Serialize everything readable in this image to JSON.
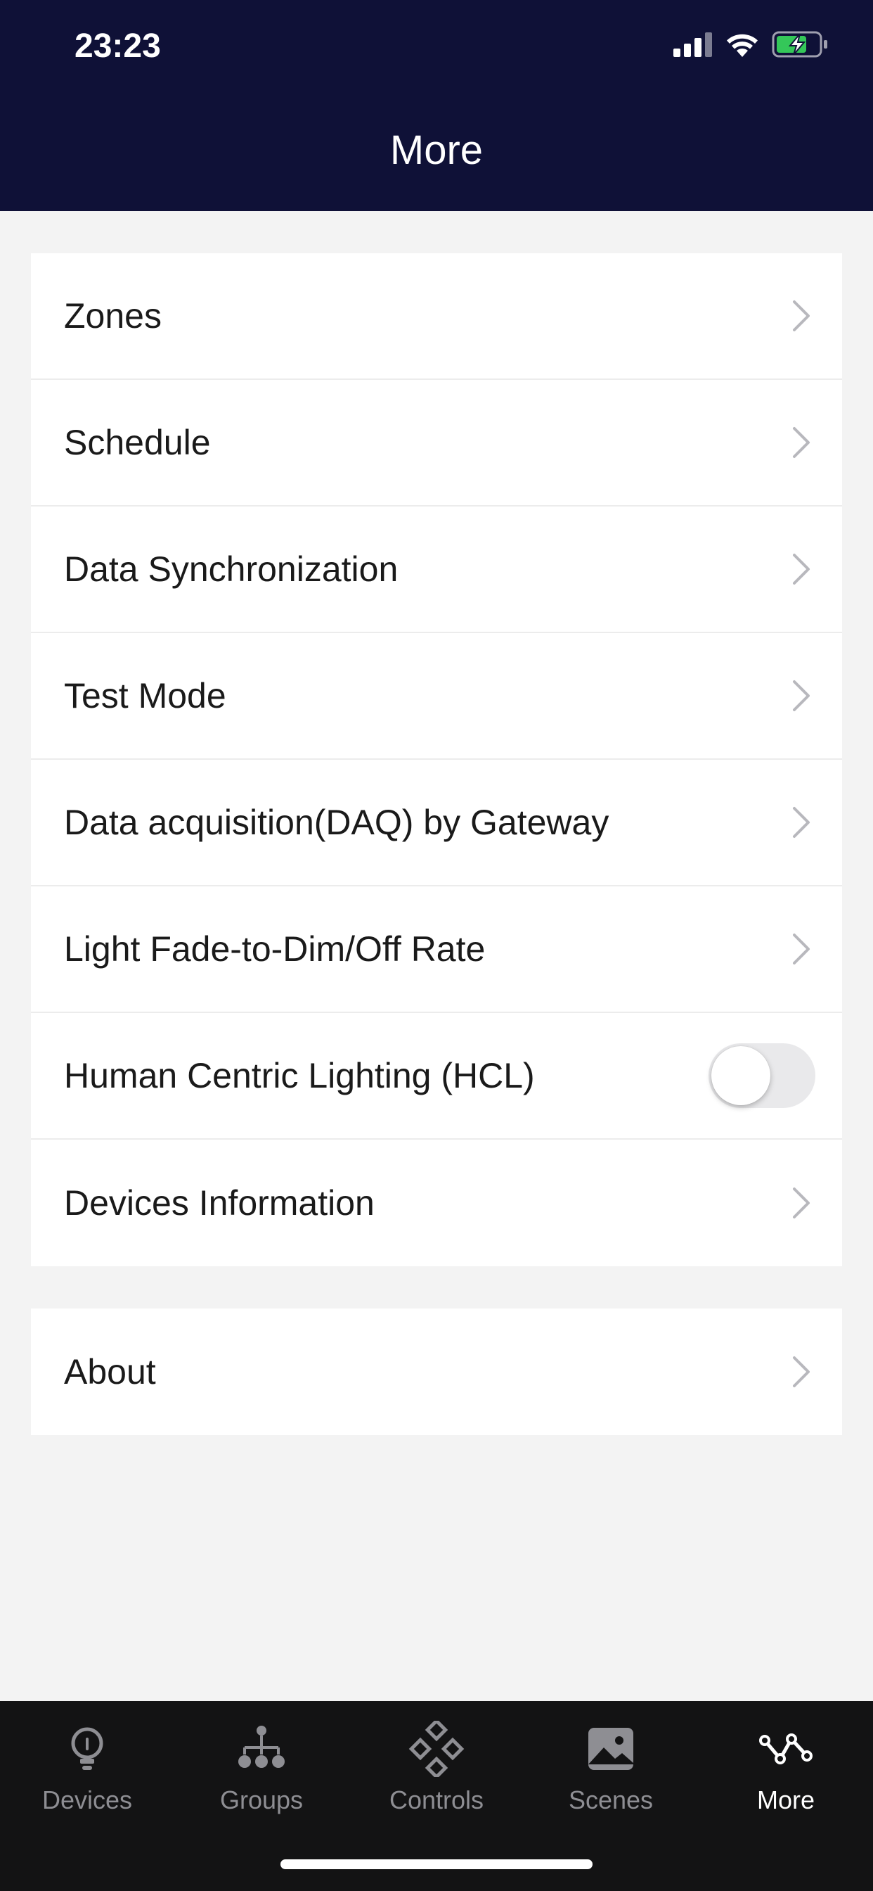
{
  "status_bar": {
    "time": "23:23",
    "icons": [
      "cellular-signal-icon",
      "wifi-icon",
      "battery-charging-icon"
    ]
  },
  "header": {
    "title": "More"
  },
  "menu": {
    "group1": [
      {
        "label": "Zones",
        "type": "chevron"
      },
      {
        "label": "Schedule",
        "type": "chevron"
      },
      {
        "label": "Data Synchronization",
        "type": "chevron"
      },
      {
        "label": "Test Mode",
        "type": "chevron"
      },
      {
        "label": "Data acquisition(DAQ) by Gateway",
        "type": "chevron"
      },
      {
        "label": "Light Fade-to-Dim/Off Rate",
        "type": "chevron"
      },
      {
        "label": "Human Centric Lighting (HCL)",
        "type": "toggle",
        "value": "off"
      },
      {
        "label": "Devices Information",
        "type": "chevron"
      }
    ],
    "group2": [
      {
        "label": "About",
        "type": "chevron"
      }
    ]
  },
  "tabbar": {
    "tabs": [
      {
        "label": "Devices",
        "icon": "bulb-icon",
        "active": false
      },
      {
        "label": "Groups",
        "icon": "hierarchy-icon",
        "active": false
      },
      {
        "label": "Controls",
        "icon": "diamond-grid-icon",
        "active": false
      },
      {
        "label": "Scenes",
        "icon": "image-icon",
        "active": false
      },
      {
        "label": "More",
        "icon": "nodes-icon",
        "active": true
      }
    ]
  },
  "colors": {
    "header_bg": "#0f1137",
    "page_bg": "#f3f3f3",
    "tabbar_bg": "#131314",
    "tab_inactive": "#8e8e93",
    "tab_active": "#ffffff",
    "battery_green": "#34c759"
  }
}
